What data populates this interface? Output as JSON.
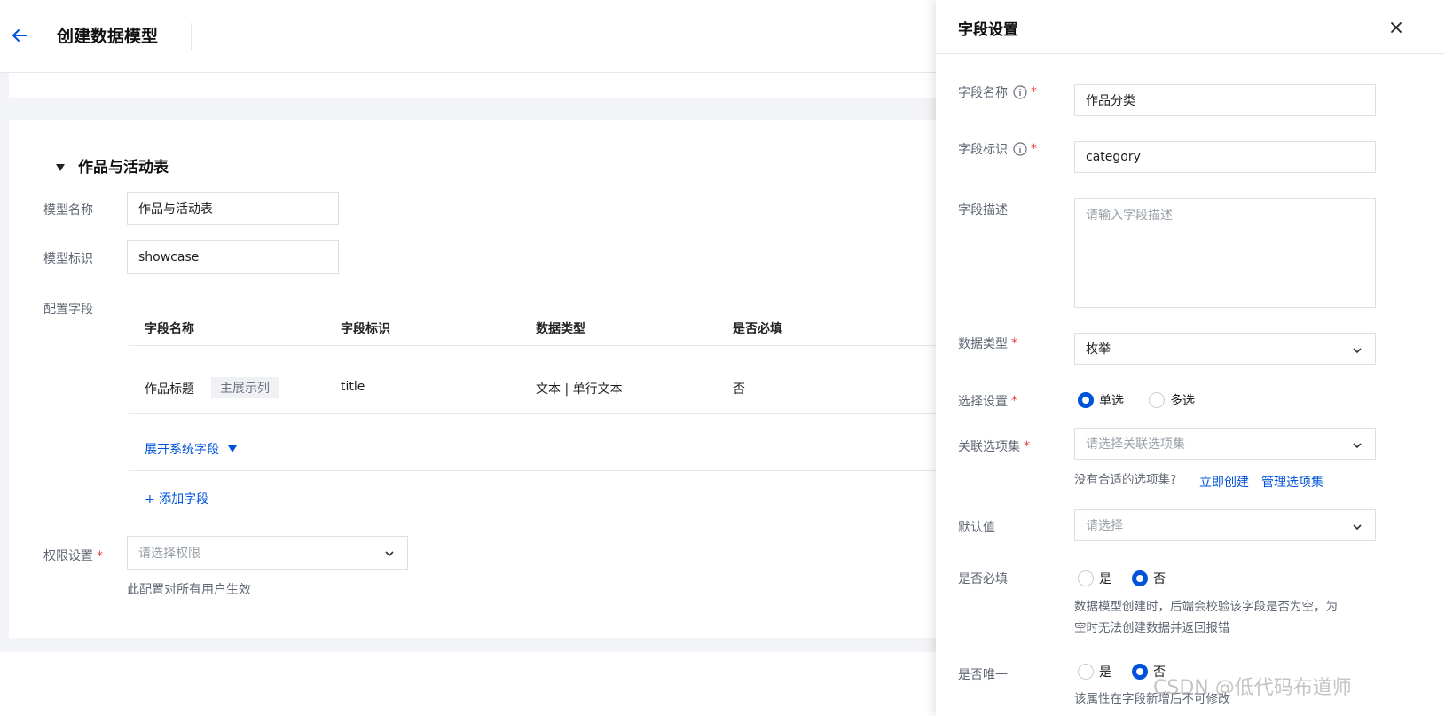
{
  "header": {
    "title": "创建数据模型"
  },
  "section": {
    "title": "作品与活动表"
  },
  "form": {
    "model_name_label": "模型名称",
    "model_name_value": "作品与活动表",
    "model_id_label": "模型标识",
    "model_id_value": "showcase",
    "fields_label": "配置字段",
    "permission_label": "权限设置",
    "permission_required": "*",
    "permission_placeholder": "请选择权限",
    "permission_hint": "此配置对所有用户生效"
  },
  "table": {
    "headers": [
      "字段名称",
      "字段标识",
      "数据类型",
      "是否必填"
    ],
    "rows": [
      {
        "name": "作品标题",
        "tag": "主展示列",
        "id": "title",
        "type": "文本 | 单行文本",
        "required": "否"
      }
    ],
    "expand_system_fields": "展开系统字段",
    "add_field": "+ 添加字段"
  },
  "drawer": {
    "title": "字段设置",
    "field_name_label": "字段名称",
    "field_name_value": "作品分类",
    "field_id_label": "字段标识",
    "field_id_value": "category",
    "field_desc_label": "字段描述",
    "field_desc_placeholder": "请输入字段描述",
    "data_type_label": "数据类型",
    "data_type_value": "枚举",
    "select_setting_label": "选择设置",
    "select_single": "单选",
    "select_multi": "多选",
    "option_set_label": "关联选项集",
    "option_set_placeholder": "请选择关联选项集",
    "option_set_hint": "没有合适的选项集?",
    "create_now": "立即创建",
    "manage_sets": "管理选项集",
    "default_label": "默认值",
    "default_placeholder": "请选择",
    "required_label": "是否必填",
    "yes": "是",
    "no": "否",
    "required_hint_1": "数据模型创建时，后端会校验该字段是否为空，为",
    "required_hint_2": "空时无法创建数据并返回报错",
    "unique_label": "是否唯一",
    "unique_hint": "该属性在字段新增后不可修改",
    "required_mark": "*"
  },
  "watermark": "CSDN @低代码布道师",
  "colors": {
    "primary": "#0052d9",
    "required": "#e54545"
  }
}
